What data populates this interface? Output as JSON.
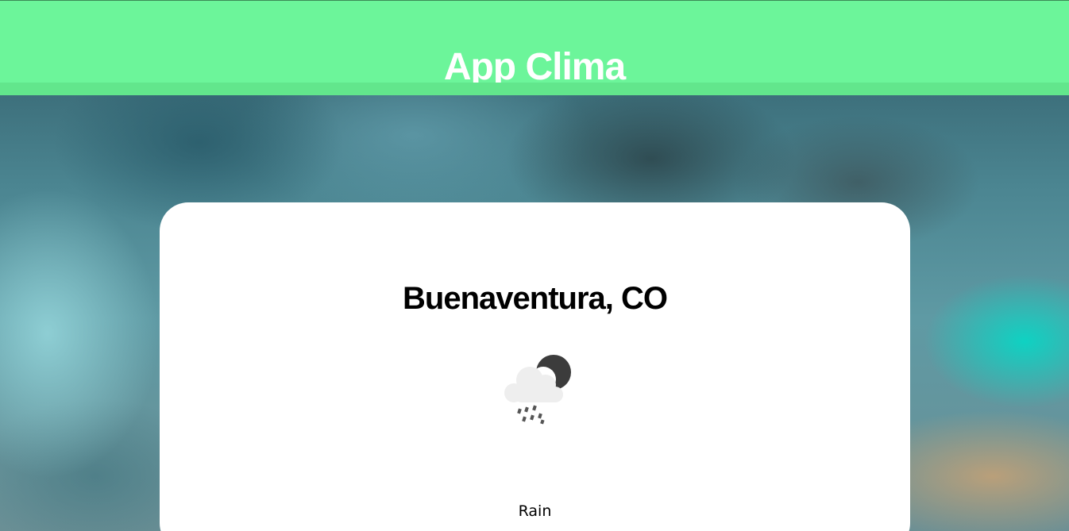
{
  "header": {
    "title": "App Clima"
  },
  "weather": {
    "city": "Buenaventura, CO",
    "condition": "Rain",
    "icon": "rain-night-icon"
  },
  "colors": {
    "header_bg": "#6cf59a",
    "header_strip": "#62e68c",
    "card_bg": "#ffffff",
    "title_text": "#ffffff"
  }
}
